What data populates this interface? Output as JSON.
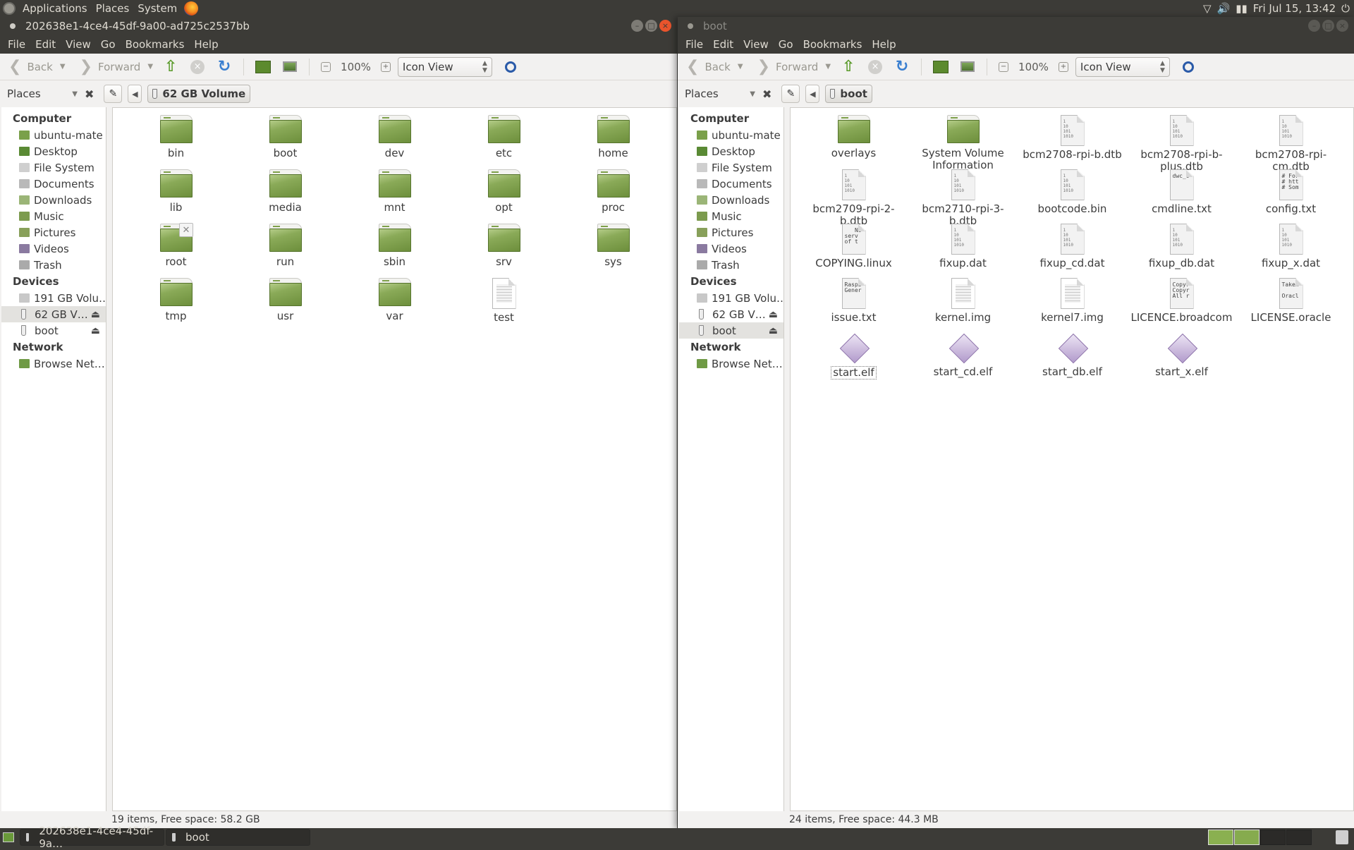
{
  "top_panel": {
    "menus": [
      "Applications",
      "Places",
      "System"
    ],
    "clock": "Fri Jul 15, 13:42"
  },
  "windows": [
    {
      "title": "202638e1-4ce4-45df-9a00-ad725c2537bb",
      "menubar": [
        "File",
        "Edit",
        "View",
        "Go",
        "Bookmarks",
        "Help"
      ],
      "toolbar": {
        "back": "Back",
        "forward": "Forward",
        "zoom": "100%",
        "view": "Icon View"
      },
      "places_label": "Places",
      "location": "62 GB Volume",
      "sidebar": {
        "computer_heading": "Computer",
        "computer": [
          "ubuntu-mate",
          "Desktop",
          "File System",
          "Documents",
          "Downloads",
          "Music",
          "Pictures",
          "Videos",
          "Trash"
        ],
        "devices_heading": "Devices",
        "devices": [
          "191 GB Volu…",
          "62 GB V…",
          "boot"
        ],
        "network_heading": "Network",
        "network": [
          "Browse Net…"
        ],
        "active_device": 1
      },
      "files": [
        {
          "name": "bin",
          "type": "folder"
        },
        {
          "name": "boot",
          "type": "folder"
        },
        {
          "name": "dev",
          "type": "folder"
        },
        {
          "name": "etc",
          "type": "folder"
        },
        {
          "name": "home",
          "type": "folder"
        },
        {
          "name": "lib",
          "type": "folder"
        },
        {
          "name": "media",
          "type": "folder"
        },
        {
          "name": "mnt",
          "type": "folder"
        },
        {
          "name": "opt",
          "type": "folder"
        },
        {
          "name": "proc",
          "type": "folder"
        },
        {
          "name": "root",
          "type": "folder"
        },
        {
          "name": "run",
          "type": "folder"
        },
        {
          "name": "sbin",
          "type": "folder"
        },
        {
          "name": "srv",
          "type": "folder"
        },
        {
          "name": "sys",
          "type": "folder"
        },
        {
          "name": "tmp",
          "type": "folder"
        },
        {
          "name": "usr",
          "type": "folder"
        },
        {
          "name": "var",
          "type": "folder"
        },
        {
          "name": "test",
          "type": "text"
        }
      ],
      "status": "19 items, Free space: 58.2 GB"
    },
    {
      "title": "boot",
      "menubar": [
        "File",
        "Edit",
        "View",
        "Go",
        "Bookmarks",
        "Help"
      ],
      "toolbar": {
        "back": "Back",
        "forward": "Forward",
        "zoom": "100%",
        "view": "Icon View"
      },
      "places_label": "Places",
      "location": "boot",
      "sidebar": {
        "computer_heading": "Computer",
        "computer": [
          "ubuntu-mate",
          "Desktop",
          "File System",
          "Documents",
          "Downloads",
          "Music",
          "Pictures",
          "Videos",
          "Trash"
        ],
        "devices_heading": "Devices",
        "devices": [
          "191 GB Volu…",
          "62 GB V…",
          "boot"
        ],
        "network_heading": "Network",
        "network": [
          "Browse Net…"
        ],
        "active_device": 2
      },
      "files": [
        {
          "name": "overlays",
          "type": "folder"
        },
        {
          "name": "System Volume Information",
          "type": "folder"
        },
        {
          "name": "bcm2708-rpi-b.dtb",
          "type": "binary"
        },
        {
          "name": "bcm2708-rpi-b-plus.dtb",
          "type": "binary"
        },
        {
          "name": "bcm2708-rpi-cm.dtb",
          "type": "binary"
        },
        {
          "name": "bcm2709-rpi-2-b.dtb",
          "type": "binary"
        },
        {
          "name": "bcm2710-rpi-3-b.dtb",
          "type": "binary"
        },
        {
          "name": "bootcode.bin",
          "type": "binary"
        },
        {
          "name": "cmdline.txt",
          "type": "text",
          "preview": "dwc_o"
        },
        {
          "name": "config.txt",
          "type": "text",
          "preview": "# For\n# htt\n# Som"
        },
        {
          "name": "COPYING.linux",
          "type": "text",
          "preview": "   NO\nserv\nof t"
        },
        {
          "name": "fixup.dat",
          "type": "binary"
        },
        {
          "name": "fixup_cd.dat",
          "type": "binary"
        },
        {
          "name": "fixup_db.dat",
          "type": "binary"
        },
        {
          "name": "fixup_x.dat",
          "type": "binary"
        },
        {
          "name": "issue.txt",
          "type": "text",
          "preview": "Raspb\nGener"
        },
        {
          "name": "kernel.img",
          "type": "lines"
        },
        {
          "name": "kernel7.img",
          "type": "lines"
        },
        {
          "name": "LICENCE.broadcom",
          "type": "text",
          "preview": "Copyr\nCopyr\nAll r"
        },
        {
          "name": "LICENSE.oracle",
          "type": "text",
          "preview": "Taken\n\nOracl"
        },
        {
          "name": "start.elf",
          "type": "elf",
          "selected": true
        },
        {
          "name": "start_cd.elf",
          "type": "elf"
        },
        {
          "name": "start_db.elf",
          "type": "elf"
        },
        {
          "name": "start_x.elf",
          "type": "elf"
        }
      ],
      "status": "24 items, Free space: 44.3 MB"
    }
  ],
  "taskbar": {
    "tasks": [
      "202638e1-4ce4-45df-9a…",
      "boot"
    ]
  }
}
